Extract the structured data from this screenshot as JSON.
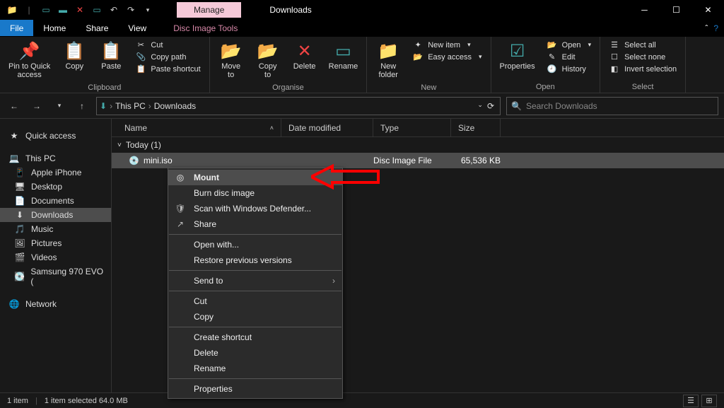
{
  "title": "Downloads",
  "manage_tab": "Manage",
  "disc_tools": "Disc Image Tools",
  "menus": {
    "file": "File",
    "home": "Home",
    "share": "Share",
    "view": "View"
  },
  "ribbon": {
    "clipboard": {
      "label": "Clipboard",
      "pin": "Pin to Quick\naccess",
      "copy": "Copy",
      "paste": "Paste",
      "cut": "Cut",
      "copy_path": "Copy path",
      "paste_shortcut": "Paste shortcut"
    },
    "organise": {
      "label": "Organise",
      "move": "Move\nto",
      "copy_to": "Copy\nto",
      "delete": "Delete",
      "rename": "Rename"
    },
    "new": {
      "label": "New",
      "new_folder": "New\nfolder",
      "new_item": "New item",
      "easy_access": "Easy access"
    },
    "open": {
      "label": "Open",
      "properties": "Properties",
      "open": "Open",
      "edit": "Edit",
      "history": "History"
    },
    "select": {
      "label": "Select",
      "select_all": "Select all",
      "select_none": "Select none",
      "invert": "Invert selection"
    }
  },
  "breadcrumb": {
    "pc": "This PC",
    "folder": "Downloads"
  },
  "search_placeholder": "Search Downloads",
  "sidebar": {
    "quick_access": "Quick access",
    "this_pc": "This PC",
    "items": [
      {
        "label": "Apple iPhone",
        "icon": "📱"
      },
      {
        "label": "Desktop",
        "icon": "🖥"
      },
      {
        "label": "Documents",
        "icon": "📄"
      },
      {
        "label": "Downloads",
        "icon": "⬇"
      },
      {
        "label": "Music",
        "icon": "🎵"
      },
      {
        "label": "Pictures",
        "icon": "🖼"
      },
      {
        "label": "Videos",
        "icon": "🎬"
      },
      {
        "label": "Samsung 970 EVO (",
        "icon": "💽"
      }
    ],
    "network": "Network"
  },
  "columns": {
    "name": "Name",
    "date": "Date modified",
    "type": "Type",
    "size": "Size"
  },
  "group": "Today (1)",
  "file": {
    "name": "mini.iso",
    "type": "Disc Image File",
    "size": "65,536 KB"
  },
  "context": {
    "mount": "Mount",
    "burn": "Burn disc image",
    "scan": "Scan with Windows Defender...",
    "share": "Share",
    "open_with": "Open with...",
    "restore": "Restore previous versions",
    "send_to": "Send to",
    "cut": "Cut",
    "copy": "Copy",
    "shortcut": "Create shortcut",
    "delete": "Delete",
    "rename": "Rename",
    "properties": "Properties"
  },
  "status": {
    "items": "1 item",
    "selected": "1 item selected  64.0 MB"
  }
}
